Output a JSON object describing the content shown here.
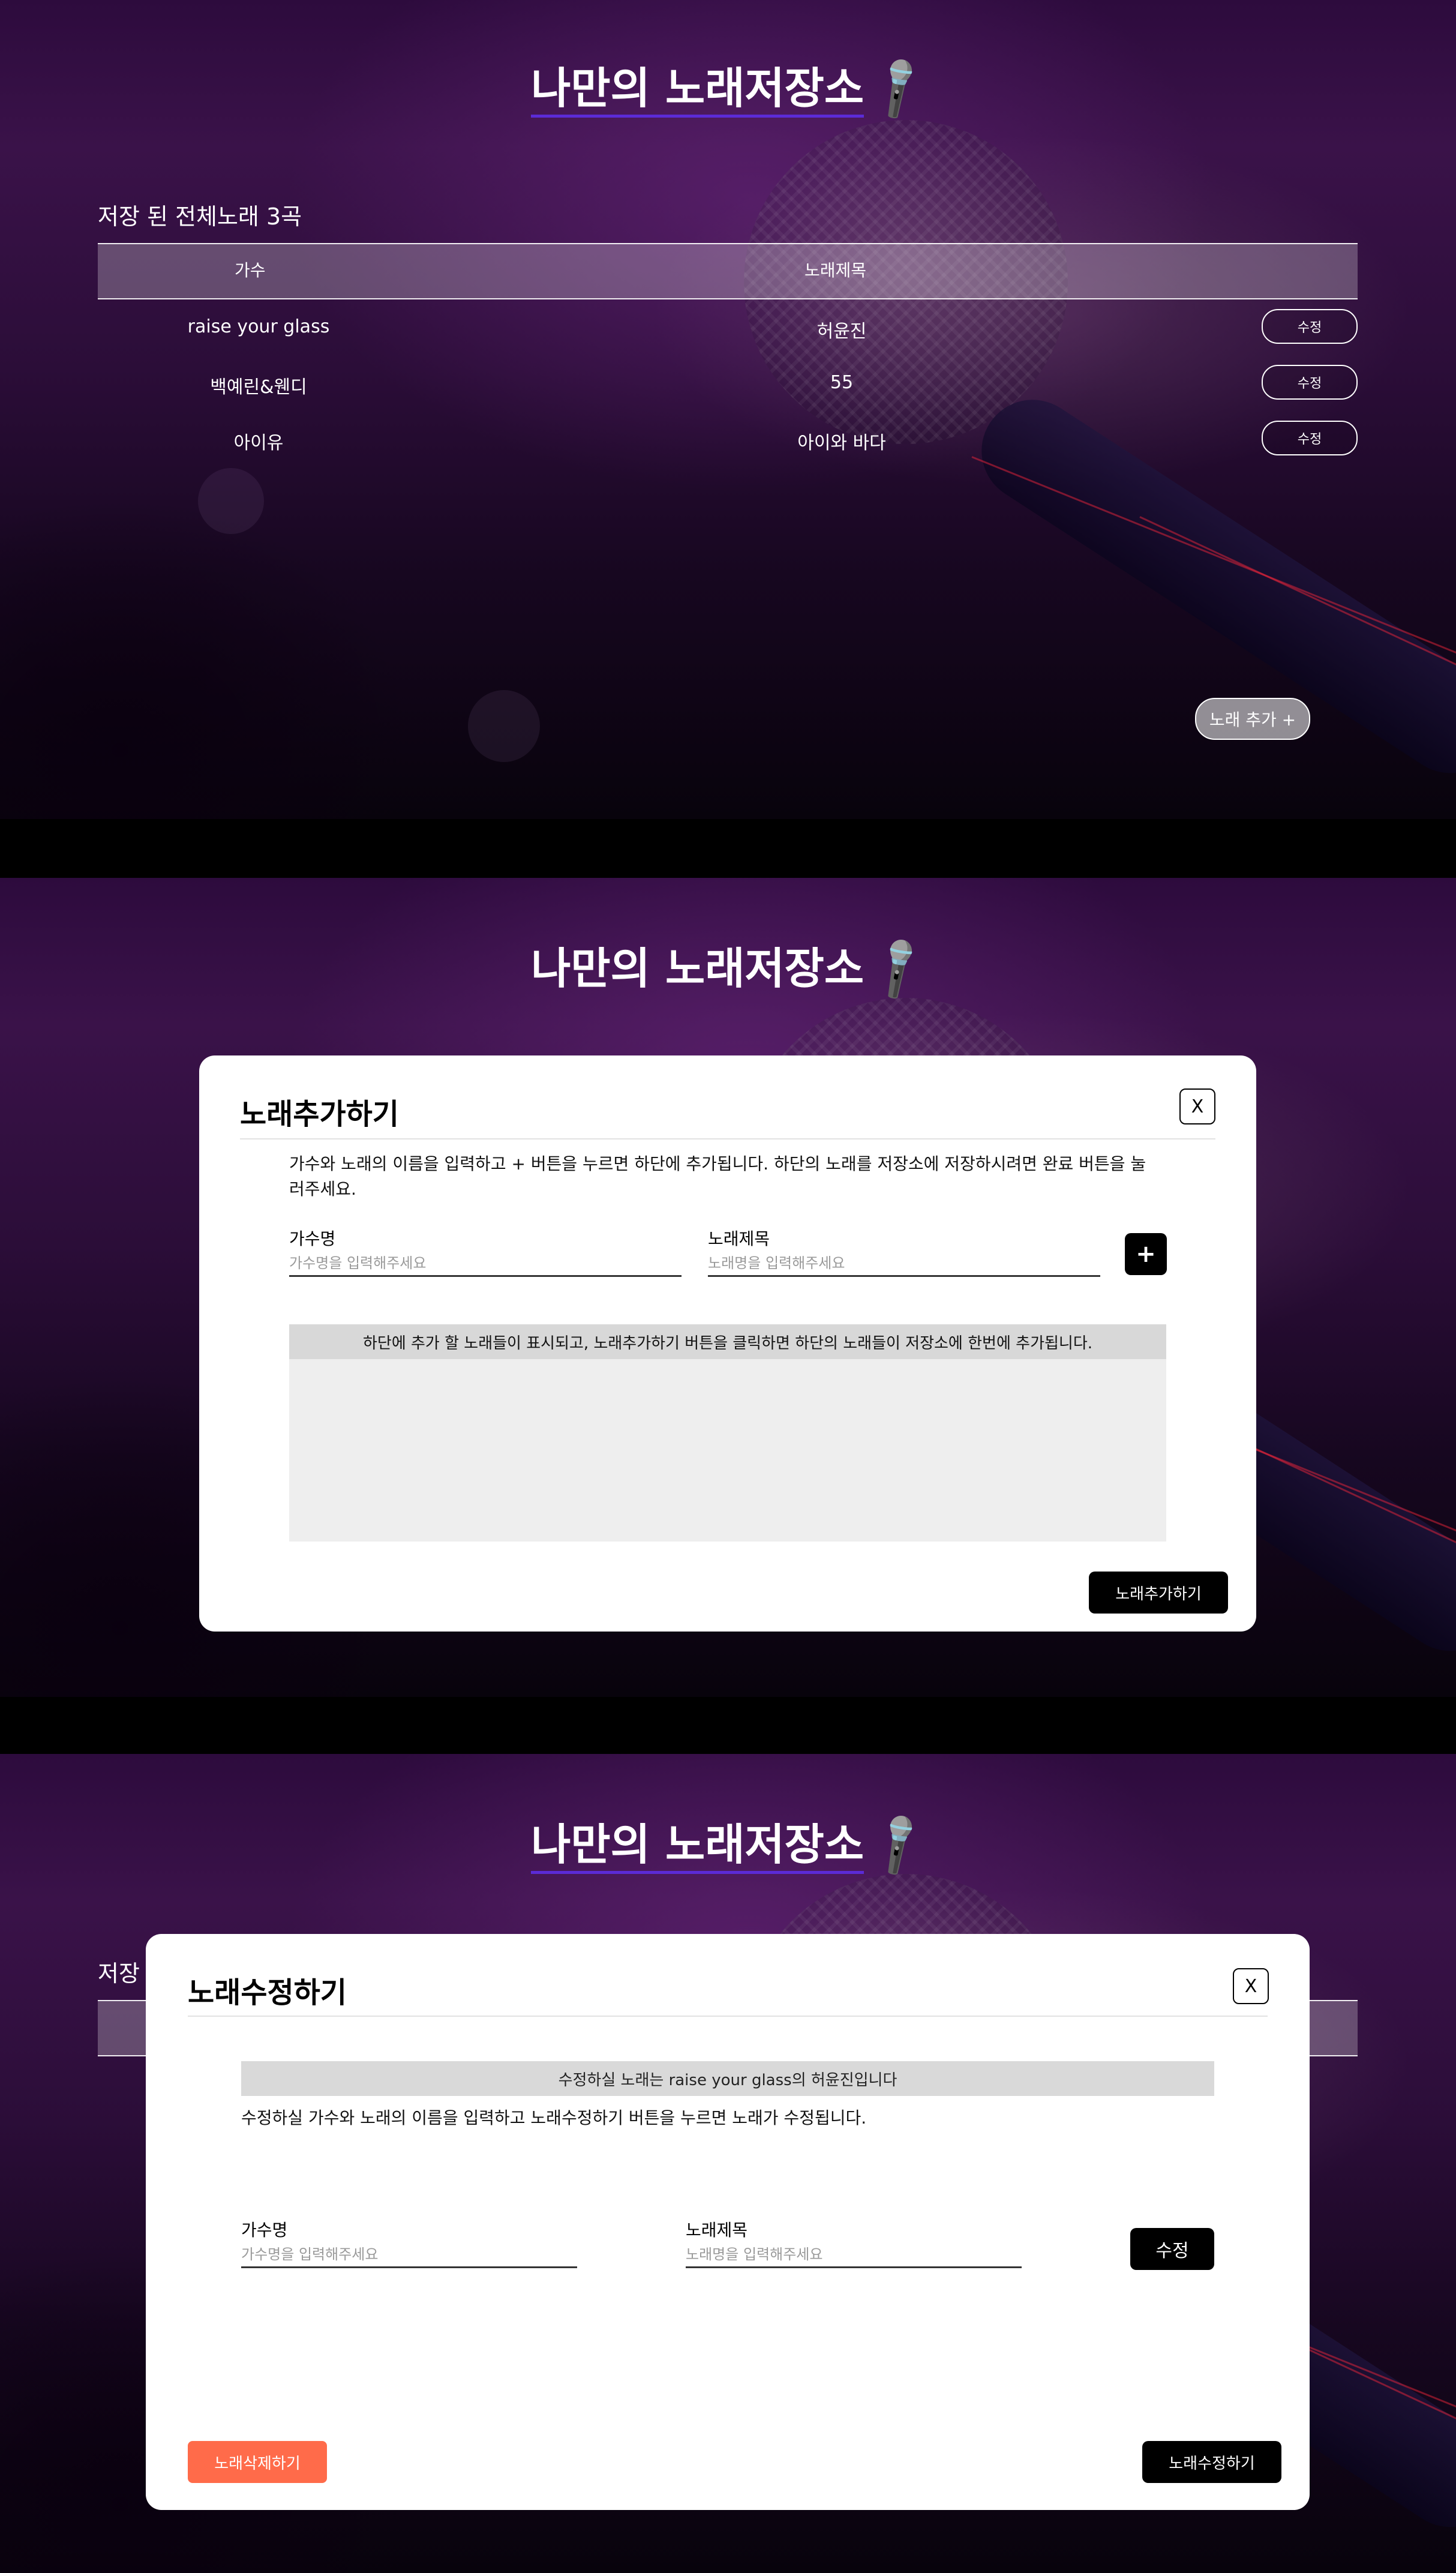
{
  "app_title": "나만의 노래저장소",
  "title_icon": "microphone-icon",
  "list_view": {
    "count_text": "저장 된 전체노래 3곡",
    "headers": {
      "singer": "가수",
      "song": "노래제목"
    },
    "rows": [
      {
        "singer": "raise your glass",
        "song": "허윤진",
        "edit_label": "수정"
      },
      {
        "singer": "백예린&웬디",
        "song": "55",
        "edit_label": "수정"
      },
      {
        "singer": "아이유",
        "song": "아이와 바다",
        "edit_label": "수정"
      }
    ],
    "add_button_label": "노래 추가 +"
  },
  "add_modal": {
    "title": "노래추가하기",
    "close_label": "X",
    "description": "가수와 노래의 이름을 입력하고 + 버튼을 누르면 하단에 추가됩니다. 하단의 노래를 저장소에 저장하시려면 완료 버튼을 눌러주세요.",
    "singer_label": "가수명",
    "singer_placeholder": "가수명을 입력해주세요",
    "song_label": "노래제목",
    "song_placeholder": "노래명을 입력해주세요",
    "plus_label": "+",
    "list_header": "하단에 추가 할 노래들이 표시되고, 노래추가하기 버튼을 클릭하면 하단의 노래들이 저장소에 한번에 추가됩니다.",
    "submit_label": "노래추가하기"
  },
  "edit_modal": {
    "background_peek": "저장",
    "title": "노래수정하기",
    "close_label": "X",
    "info": "수정하실 노래는 raise your glass의 허윤진입니다",
    "description": "수정하실 가수와 노래의 이름을 입력하고 노래수정하기 버튼을 누르면 노래가 수정됩니다.",
    "singer_label": "가수명",
    "singer_placeholder": "가수명을 입력해주세요",
    "song_label": "노래제목",
    "song_placeholder": "노래명을 입력해주세요",
    "edit_label": "수정",
    "delete_label": "노래삭제하기",
    "submit_label": "노래수정하기"
  },
  "colors": {
    "accent_underline": "#5b2bd6",
    "delete_button": "#ff6b4a",
    "primary_button": "#000000"
  }
}
